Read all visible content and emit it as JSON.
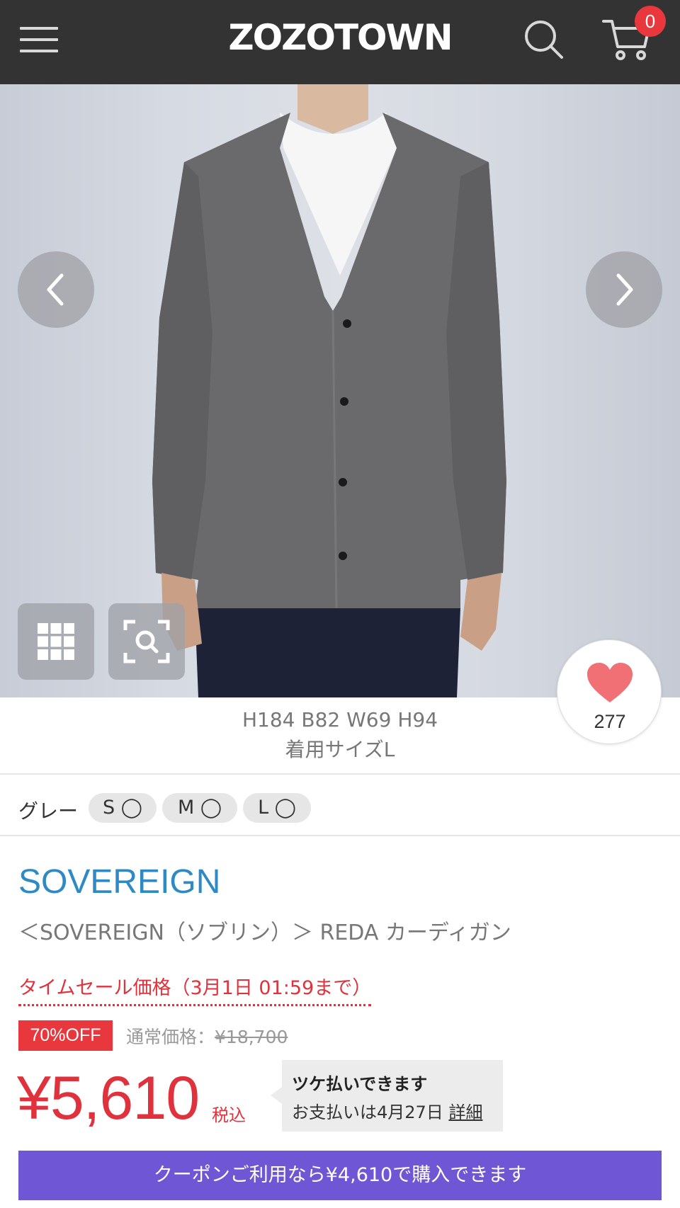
{
  "header": {
    "logo": "ZOZOTOWN",
    "cart_count": "0"
  },
  "gallery": {
    "favorite_count": "277"
  },
  "model": {
    "measurements": "H184 B82 W69 H94",
    "wearing_size": "着用サイズL"
  },
  "variants": {
    "color": "グレー",
    "sizes": [
      {
        "label": "S ◯"
      },
      {
        "label": "M ◯"
      },
      {
        "label": "L ◯"
      }
    ]
  },
  "product": {
    "brand": "SOVEREIGN",
    "name": "＜SOVEREIGN（ソブリン）＞ REDA カーディガン"
  },
  "pricing": {
    "sale_label": "タイムセール価格（3月1日 01:59まで）",
    "discount_badge": "70%OFF",
    "regular_label": "通常価格：",
    "regular_price": "¥18,700",
    "price": "¥5,610",
    "tax_label": "税込"
  },
  "tsuke": {
    "title": "ツケ払いできます",
    "sub": "お支払いは4月27日",
    "link": "詳細"
  },
  "coupon": {
    "text": "クーポンご利用なら¥4,610で購入できます"
  },
  "colors": {
    "header_bg": "#333333",
    "accent_red": "#e8383d",
    "brand_blue": "#2f89c5",
    "coupon_purple": "#6f56d4"
  },
  "icons": [
    "menu-icon",
    "search-icon",
    "cart-icon",
    "chevron-left-icon",
    "chevron-right-icon",
    "grid-icon",
    "zoom-scan-icon",
    "heart-icon"
  ]
}
